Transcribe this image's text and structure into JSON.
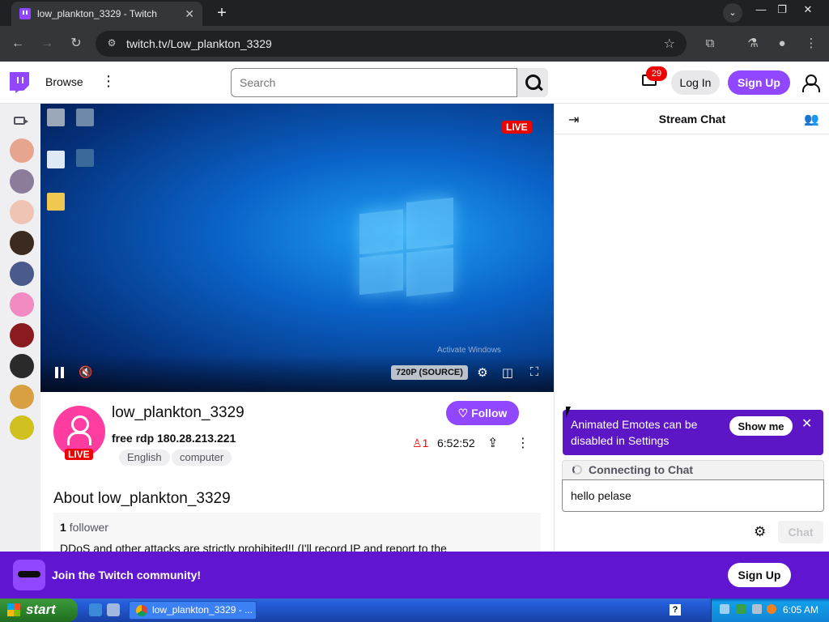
{
  "browser": {
    "tab_title": "low_plankton_3329 - Twitch",
    "tab_close": "✕",
    "new_tab": "+",
    "url": "twitch.tv/Low_plankton_3329"
  },
  "twitch_nav": {
    "browse_label": "Browse",
    "search_placeholder": "Search",
    "notification_count": "29",
    "login_label": "Log In",
    "signup_label": "Sign Up"
  },
  "player": {
    "live_label": "LIVE",
    "quality_label": "720P (SOURCE)",
    "watermark_text": "Activate Windows"
  },
  "channel": {
    "name": "low_plankton_3329",
    "live_label": "LIVE",
    "stream_title": "free rdp 180.28.213.221",
    "tags": [
      "English",
      "computer"
    ],
    "follow_label": "Follow",
    "viewer_count": "1",
    "uptime": "6:52:52",
    "about_heading": "About low_plankton_3329",
    "follower_count": "1",
    "follower_label": "follower",
    "description": "DDoS and other attacks are strictly prohibited!! (I'll record IP and report to the"
  },
  "chat": {
    "title": "Stream Chat",
    "emote_banner_text": "Animated Emotes can be disabled in Settings",
    "show_me_label": "Show me",
    "connecting_text": "Connecting to Chat",
    "input_value": "hello pelase",
    "chat_button_label": "Chat"
  },
  "join_banner": {
    "text": "Join the Twitch community!",
    "signup_label": "Sign Up"
  },
  "taskbar": {
    "start_label": "start",
    "task_label": "low_plankton_3329 - ...",
    "clock": "6:05 AM"
  },
  "colors": {
    "twitch_purple": "#9146ff",
    "live_red": "#eb0400",
    "banner_purple": "#5c16c5"
  }
}
